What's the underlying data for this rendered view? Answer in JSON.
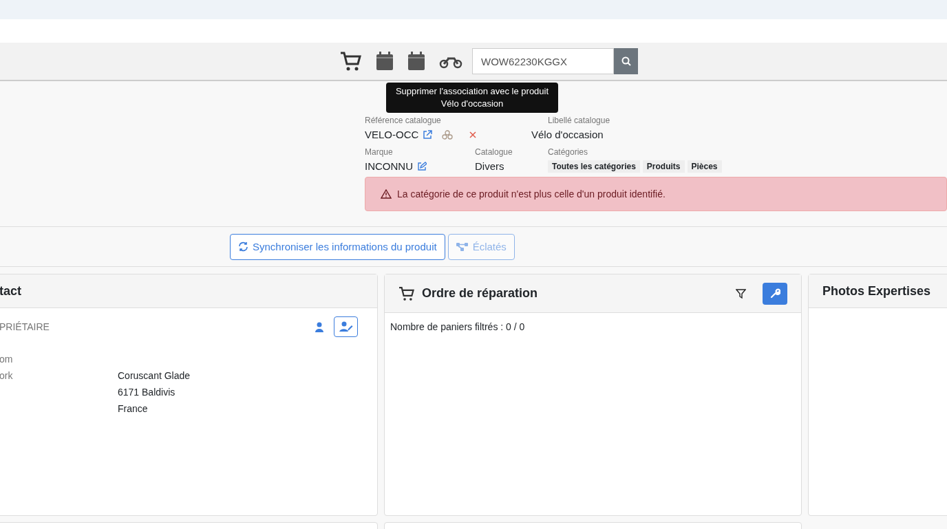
{
  "toolbar": {
    "search": {
      "value": "WOW62230KGGX"
    }
  },
  "tooltip": {
    "text": "Supprimer l'association avec le produit Vélo d'occasion"
  },
  "product": {
    "reference": {
      "label": "Référence catalogue",
      "value": "VELO-OCC"
    },
    "libelle": {
      "label": "Libellé catalogue",
      "value": "Vélo d'occasion"
    },
    "marque": {
      "label": "Marque",
      "value": "INCONNU"
    },
    "catalogue": {
      "label": "Catalogue",
      "value": "Divers"
    },
    "categories": {
      "label": "Catégories",
      "tags": [
        "Toutes les catégories",
        "Produits",
        "Pièces"
      ]
    },
    "alert": "La catégorie de ce produit n'est plus celle d'un produit identifié."
  },
  "actions": [
    {
      "label": "Synchroniser les informations du produit",
      "disabled": false,
      "kind": "sync"
    },
    {
      "label": "Éclatés",
      "disabled": true,
      "kind": "tree"
    }
  ],
  "contact_card": {
    "title": "tact",
    "role": "PRIÉTAIRE",
    "rows": [
      {
        "label": "om",
        "value": ""
      },
      {
        "label": "ork",
        "value": "Coruscant Glade"
      },
      {
        "label": "",
        "value": "6171 Baldivis"
      },
      {
        "label": "",
        "value": "France"
      }
    ]
  },
  "repair_card": {
    "title": "Ordre de réparation",
    "count_text": "Nombre de paniers filtrés : 0 / 0"
  },
  "photos_card": {
    "title": "Photos Expertises"
  }
}
